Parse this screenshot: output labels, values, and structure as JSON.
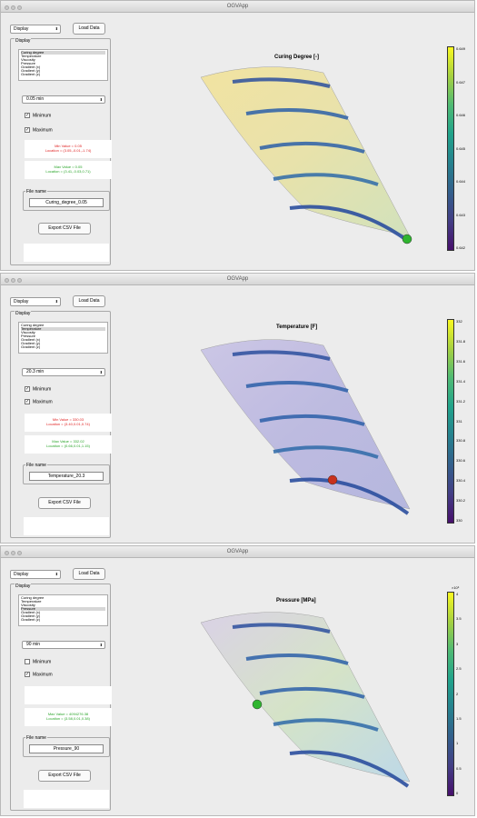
{
  "app_title": "OGVApp",
  "list_items": [
    "Curing degree",
    "Temperature",
    "Viscosity",
    "Pressure",
    "Gradient (x)",
    "Gradient (y)",
    "Gradient (z)"
  ],
  "windows": [
    {
      "title": "OGVApp",
      "dropdown": "Display",
      "load_btn": "Load Data",
      "panel_label": "Display",
      "selected_index": 0,
      "time": "0.05 min",
      "min_checked": true,
      "max_checked": true,
      "min_label": "Minimum",
      "max_label": "Maximum",
      "min_value": "Min Value = 0.05",
      "min_loc": "Location = (3.05,-0.01,-1.74)",
      "max_value": "Max Value = 0.05",
      "max_loc": "Location = (3.41,-0.03,0.71)",
      "file_label": "File name",
      "file_name": "Curing_degree_0.05",
      "export_btn": "Export CSV File",
      "plot_title": "Curing Degree [-]",
      "ticks": [
        "0.649",
        "0.647",
        "0.646",
        "0.645",
        "0.644",
        "0.643",
        "0.642"
      ],
      "exponent": "",
      "marker_color": "#2fb52f"
    },
    {
      "title": "OGVApp",
      "dropdown": "Display",
      "load_btn": "Load Data",
      "panel_label": "Display",
      "selected_index": 1,
      "time": "20.3 min",
      "min_checked": true,
      "max_checked": true,
      "min_label": "Minimum",
      "max_label": "Maximum",
      "min_value": "Min Value = 330.03",
      "min_loc": "Location = (3.40,0.01,0.74)",
      "max_value": "Max Value = 332.02",
      "max_loc": "Location = (0.66,0.01,1.15)",
      "file_label": "File name",
      "file_name": "Temperature_20.3",
      "export_btn": "Export CSV File",
      "plot_title": "Temperature [F]",
      "ticks": [
        "332",
        "331.8",
        "331.6",
        "331.4",
        "331.2",
        "331",
        "330.8",
        "330.6",
        "330.4",
        "330.2",
        "330"
      ],
      "exponent": "",
      "marker_color": "#c8311c"
    },
    {
      "title": "OGVApp",
      "dropdown": "Display",
      "load_btn": "Load Data",
      "panel_label": "Display",
      "selected_index": 3,
      "time": "90 min",
      "min_checked": false,
      "max_checked": true,
      "min_label": "Minimum",
      "max_label": "Maximum",
      "min_value": "",
      "min_loc": "",
      "max_value": "Max Value = 4094276.38",
      "max_loc": "Location = (3.58,0.01,0.38)",
      "file_label": "File name",
      "file_name": "Pressure_90",
      "export_btn": "Export CSV File",
      "plot_title": "Pressure [MPa]",
      "ticks": [
        "4",
        "3.5",
        "3",
        "2.5",
        "2",
        "1.5",
        "1",
        "0.5",
        "0"
      ],
      "exponent": "×10⁶",
      "marker_color": "#2fb52f"
    }
  ]
}
